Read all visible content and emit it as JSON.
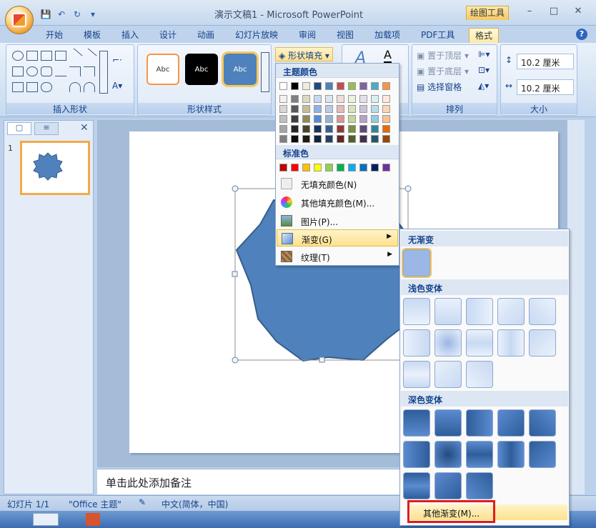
{
  "window": {
    "title": "演示文稿1 - Microsoft PowerPoint",
    "contextual_tab": "绘图工具",
    "controls": [
      "–",
      "□",
      "✕"
    ]
  },
  "quick_access": {
    "save": "💾",
    "undo": "↶",
    "redo": "↻",
    "more": "▾"
  },
  "tabs": [
    {
      "label": "开始"
    },
    {
      "label": "模板"
    },
    {
      "label": "插入"
    },
    {
      "label": "设计"
    },
    {
      "label": "动画"
    },
    {
      "label": "幻灯片放映"
    },
    {
      "label": "审阅"
    },
    {
      "label": "视图"
    },
    {
      "label": "加载项"
    },
    {
      "label": "PDF工具"
    },
    {
      "label": "格式",
      "active": true
    }
  ],
  "ribbon": {
    "insert_shapes": {
      "label": "插入形状"
    },
    "shape_styles": {
      "label": "形状样式",
      "style_sample": "Abc",
      "fill_button": "形状填充"
    },
    "arrange": {
      "label": "排列",
      "bring_front": "置于顶层",
      "send_back": "置于底层",
      "selection_pane": "选择窗格"
    },
    "size": {
      "label": "大小",
      "height": "10.2 厘米",
      "width": "10.2 厘米"
    }
  },
  "fill_menu": {
    "theme_colors_header": "主题颜色",
    "theme_colors": [
      "#ffffff",
      "#000000",
      "#eeece1",
      "#1f497d",
      "#4f81bd",
      "#c0504d",
      "#9bbb59",
      "#8064a2",
      "#4bacc6",
      "#f79646"
    ],
    "theme_tints": [
      [
        "#f2f2f2",
        "#7f7f7f",
        "#ddd9c3",
        "#c6d9f0",
        "#dbe5f1",
        "#f2dcdb",
        "#ebf1dd",
        "#e5e0ec",
        "#dbeef3",
        "#fdeada"
      ],
      [
        "#d8d8d8",
        "#595959",
        "#c4bd97",
        "#8db3e2",
        "#b8cce4",
        "#e5b9b7",
        "#d7e3bc",
        "#ccc1d9",
        "#b7dde8",
        "#fbd5b5"
      ],
      [
        "#bfbfbf",
        "#3f3f3f",
        "#938953",
        "#548dd4",
        "#95b3d7",
        "#d99694",
        "#c3d69b",
        "#b2a2c7",
        "#92cddc",
        "#fac08f"
      ],
      [
        "#a5a5a5",
        "#262626",
        "#494429",
        "#17365d",
        "#366092",
        "#953734",
        "#76923c",
        "#5f497a",
        "#31859b",
        "#e36c09"
      ],
      [
        "#7f7f7f",
        "#0c0c0c",
        "#1d1b10",
        "#0f243e",
        "#244061",
        "#632423",
        "#4f6128",
        "#3f3151",
        "#205867",
        "#974806"
      ]
    ],
    "standard_header": "标准色",
    "standard_colors": [
      "#c00000",
      "#ff0000",
      "#ffc000",
      "#ffff00",
      "#92d050",
      "#00b050",
      "#00b0f0",
      "#0070c0",
      "#002060",
      "#7030a0"
    ],
    "items": [
      {
        "label": "无填充颜色(N)",
        "icon": "no-fill-icon"
      },
      {
        "label": "其他填充颜色(M)...",
        "icon": "color-palette-icon"
      },
      {
        "label": "图片(P)...",
        "icon": "picture-icon"
      },
      {
        "label": "渐变(G)",
        "icon": "gradient-icon",
        "highlighted": true
      },
      {
        "label": "纹理(T)",
        "icon": "texture-icon"
      }
    ]
  },
  "gradient_menu": {
    "no_gradient": "无渐变",
    "light_header": "浅色变体",
    "dark_header": "深色变体",
    "more": "其他渐变(M)..."
  },
  "left_panel": {
    "close": "✕",
    "slide_number": "1"
  },
  "notes_placeholder": "单击此处添加备注",
  "status": {
    "slide": "幻灯片 1/1",
    "theme": "\"Office 主题\"",
    "language": "中文(简体，中国)"
  },
  "colors": {
    "shape": "#4f81bd",
    "shape_border": "#385d8a",
    "accent": "#f3a94a",
    "highlight": "#e11b1b"
  }
}
